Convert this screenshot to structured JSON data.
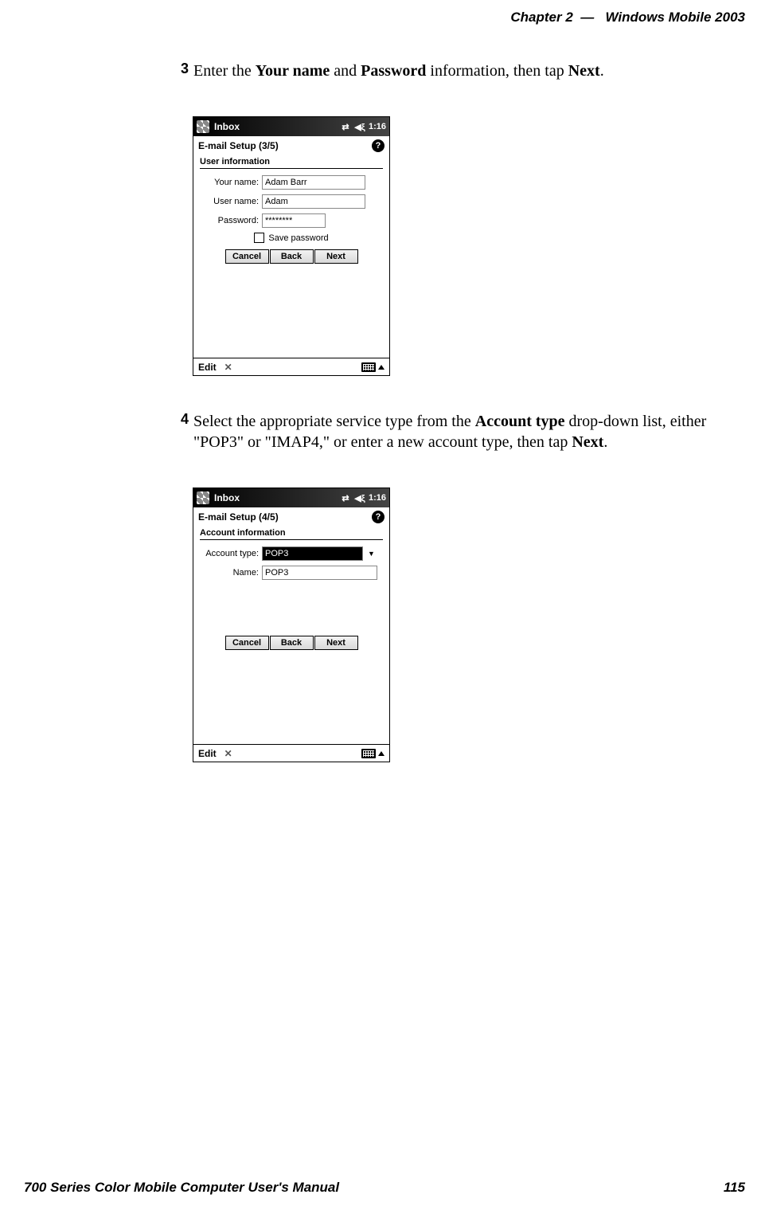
{
  "header": {
    "chapter": "Chapter",
    "chapter_num": "2",
    "dash": "—",
    "title": "Windows Mobile 2003"
  },
  "step3": {
    "num": "3",
    "text_before": "Enter the ",
    "bold1": "Your name",
    "text_mid1": " and ",
    "bold2": "Password",
    "text_mid2": " information, then tap ",
    "bold3": "Next",
    "text_after": "."
  },
  "screenshot1": {
    "title": "Inbox",
    "clock": "1:16",
    "page": "E-mail Setup (3/5)",
    "section": "User information",
    "rows": {
      "your_name_label": "Your name:",
      "your_name_value": "Adam Barr",
      "user_name_label": "User name:",
      "user_name_value": "Adam",
      "password_label": "Password:",
      "password_value": "********"
    },
    "save_password": "Save password",
    "buttons": {
      "cancel": "Cancel",
      "back": "Back",
      "next": "Next"
    },
    "bottom_edit": "Edit"
  },
  "step4": {
    "num": "4",
    "text_before": "Select the appropriate service type from the ",
    "bold1": "Account type",
    "text_mid1": " drop-down list, either \"POP3\" or \"IMAP4,\" or enter a new account type, then tap ",
    "bold2": "Next",
    "text_after": "."
  },
  "screenshot2": {
    "title": "Inbox",
    "clock": "1:16",
    "page": "E-mail Setup (4/5)",
    "section": "Account information",
    "rows": {
      "account_type_label": "Account type:",
      "account_type_value": "POP3",
      "name_label": "Name:",
      "name_value": "POP3"
    },
    "buttons": {
      "cancel": "Cancel",
      "back": "Back",
      "next": "Next"
    },
    "bottom_edit": "Edit"
  },
  "footer": {
    "manual": "700 Series Color Mobile Computer User's Manual",
    "page": "115"
  }
}
